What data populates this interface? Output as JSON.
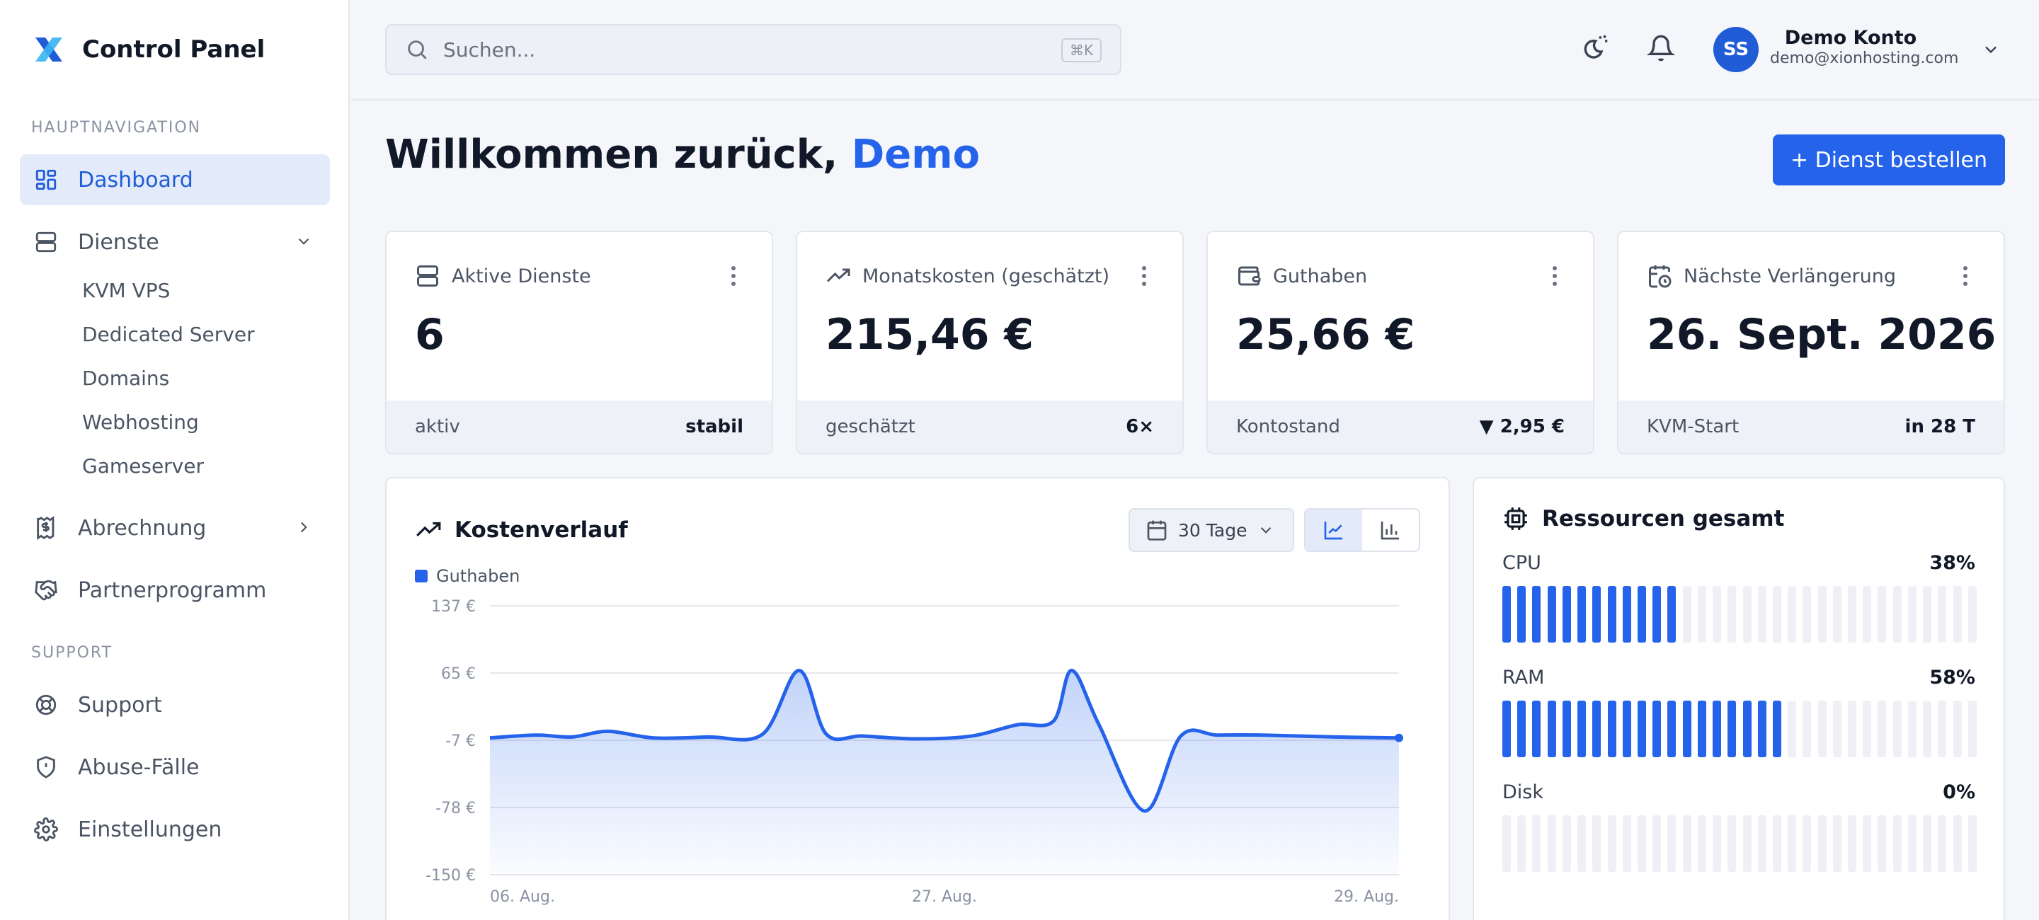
{
  "brand": {
    "title": "Control Panel"
  },
  "sidebar": {
    "section_main": "HAUPTNAVIGATION",
    "dashboard": "Dashboard",
    "dienste": "Dienste",
    "sub": [
      "KVM VPS",
      "Dedicated Server",
      "Domains",
      "Webhosting",
      "Gameserver"
    ],
    "abrechnung": "Abrechnung",
    "partner": "Partnerprogramm",
    "section_support": "SUPPORT",
    "support": "Support",
    "abuse": "Abuse-Fälle",
    "settings": "Einstellungen"
  },
  "header": {
    "search_placeholder": "Suchen...",
    "shortcut": "⌘K",
    "avatar_initials": "SS",
    "user_name": "Demo Konto",
    "user_email": "demo@xionhosting.com"
  },
  "main": {
    "welcome_prefix": "Willkommen zurück,",
    "welcome_name": "Demo",
    "order_button": "+ Dienst bestellen"
  },
  "cards": [
    {
      "title": "Aktive Dienste",
      "value": "6",
      "foot_left": "aktiv",
      "foot_right": "stabil"
    },
    {
      "title": "Monatskosten (geschätzt)",
      "value": "215,46 €",
      "foot_left": "geschätzt",
      "foot_right": "6×"
    },
    {
      "title": "Guthaben",
      "value": "25,66 €",
      "foot_left": "Kontostand",
      "foot_right": "▼ 2,95 €"
    },
    {
      "title": "Nächste Verlängerung",
      "value": "26. Sept. 2026",
      "foot_left": "KVM-Start",
      "foot_right": "in 28 T"
    }
  ],
  "cost_panel": {
    "title": "Kostenverlauf",
    "range": "30 Tage"
  },
  "chart_data": {
    "type": "area",
    "series": [
      {
        "name": "Guthaben",
        "x": [
          0,
          0.05,
          0.09,
          0.13,
          0.18,
          0.24,
          0.3,
          0.34,
          0.37,
          0.41,
          0.47,
          0.53,
          0.58,
          0.62,
          0.64,
          0.67,
          0.72,
          0.76,
          0.8,
          0.85,
          0.93,
          1.0
        ],
        "values": [
          -4,
          -1,
          -3,
          3,
          -4,
          -3,
          0,
          68,
          0,
          -2,
          -5,
          -2,
          10,
          14,
          68,
          10,
          -82,
          -2,
          -1,
          -1,
          -3,
          -4
        ]
      }
    ],
    "x_ticks": [
      "06. Aug.",
      "27. Aug.",
      "29. Aug."
    ],
    "y_ticks": [
      "137 €",
      "65 €",
      "-7 €",
      "-78 €",
      "-150 €"
    ],
    "ylim": [
      -150,
      137
    ],
    "grid": true,
    "legend": "top-left",
    "color": "#2563eb"
  },
  "resources": {
    "title": "Ressourcen gesamt",
    "items": [
      {
        "label": "CPU",
        "pct_text": "38%",
        "fraction": 0.38
      },
      {
        "label": "RAM",
        "pct_text": "58%",
        "fraction": 0.58
      },
      {
        "label": "Disk",
        "pct_text": "0%",
        "fraction": 0.0
      }
    ]
  },
  "colors": {
    "accent": "#2563eb",
    "accent_soft": "#e3ebfb",
    "text": "#111827",
    "muted": "#4b5563"
  }
}
